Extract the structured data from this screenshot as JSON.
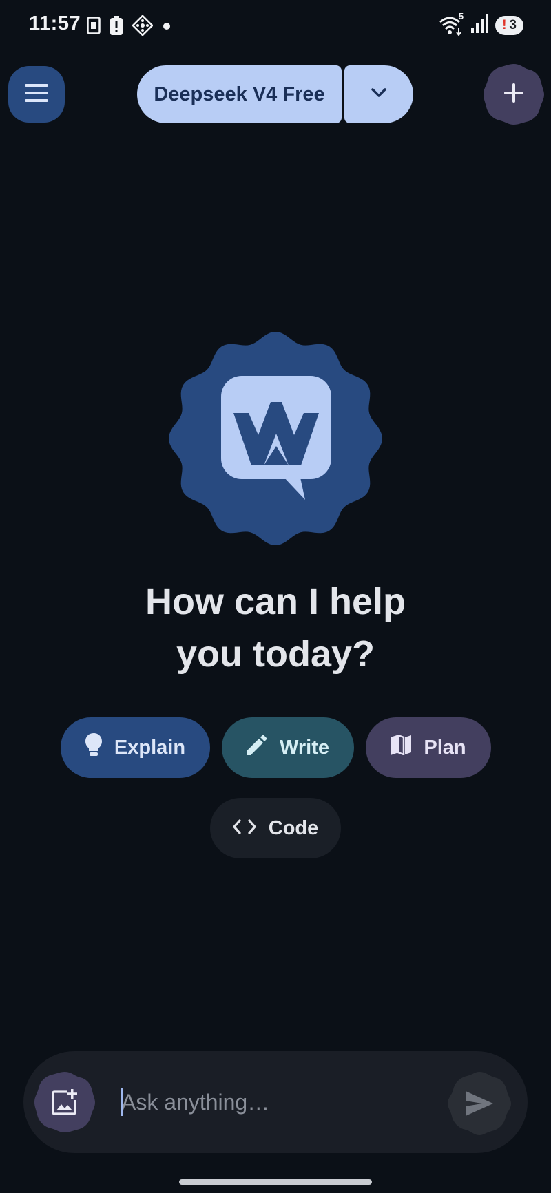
{
  "status_bar": {
    "time": "11:57",
    "notification_badge": "3",
    "notification_badge_alert": "!",
    "wifi_label": "5",
    "icons": [
      "sim-card-icon",
      "battery-alert-icon",
      "connect-icon",
      "dot-icon",
      "wifi-icon",
      "signal-icon"
    ]
  },
  "top_bar": {
    "menu_icon": "hamburger-menu-icon",
    "model_name": "Deepseek V4 Free",
    "model_dropdown_icon": "chevron-down-icon",
    "new_chat_icon": "plus-icon"
  },
  "main": {
    "logo_icon": "app-logo-chat-bubble-icon",
    "greeting": "How can I help you today?"
  },
  "suggestions": [
    {
      "label": "Explain",
      "icon": "lightbulb-icon",
      "color": "#284a80"
    },
    {
      "label": "Write",
      "icon": "pencil-icon",
      "color": "#275464"
    },
    {
      "label": "Plan",
      "icon": "map-icon",
      "color": "#433f5f"
    },
    {
      "label": "Code",
      "icon": "code-brackets-icon",
      "color": "#1a1f27"
    }
  ],
  "composer": {
    "placeholder": "Ask anything…",
    "value": "",
    "attach_icon": "add-image-icon",
    "send_icon": "send-icon"
  },
  "colors": {
    "background": "#0b1017",
    "accent_light": "#b8cdf5",
    "accent_dark": "#284a80"
  }
}
